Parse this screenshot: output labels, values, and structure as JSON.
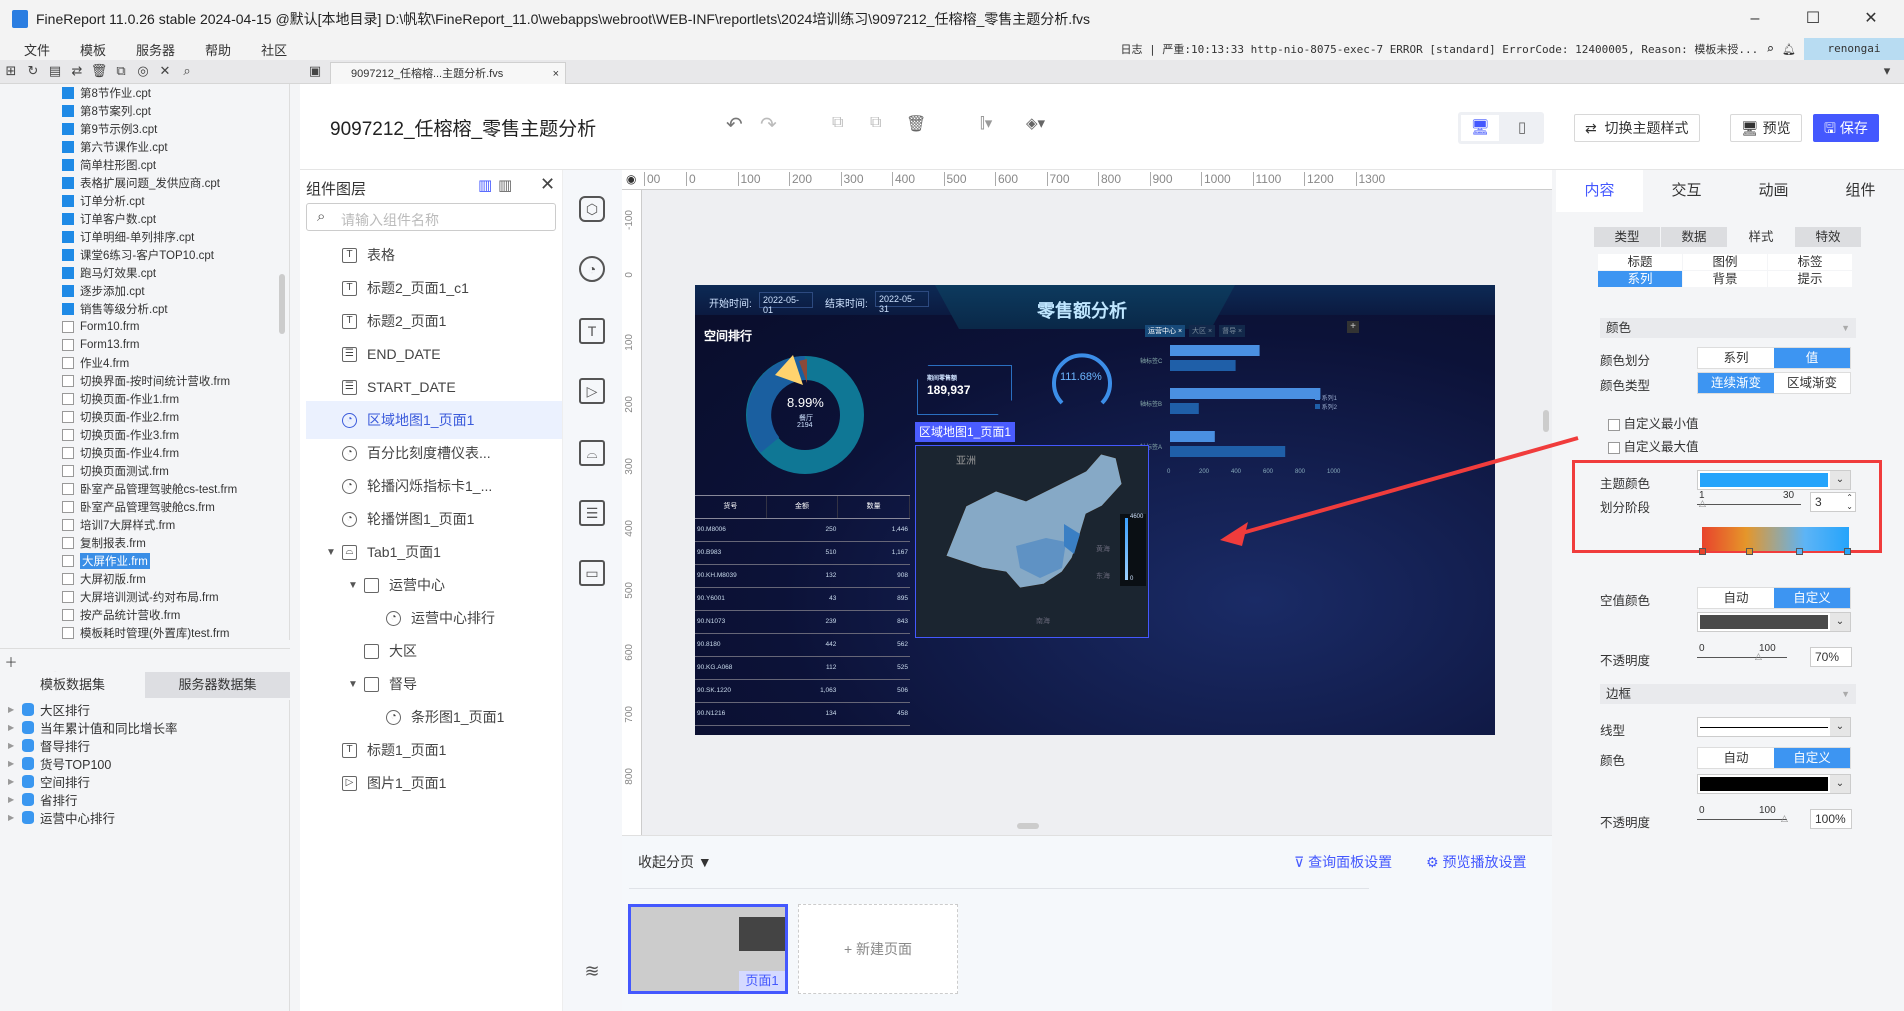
{
  "window": {
    "title": "FineReport 11.0.26 stable 2024-04-15 @默认[本地目录]   D:\\帆软\\FineReport_11.0\\webapps\\webroot\\WEB-INF\\reportlets\\2024培训练习\\9097212_任榕榕_零售主题分析.fvs",
    "minimize": "–",
    "maximize": "☐",
    "close": "✕"
  },
  "menu": [
    "文件",
    "模板",
    "服务器",
    "帮助",
    "社区"
  ],
  "log": {
    "label": "日志",
    "message": "严重:10:13:33 http-nio-8075-exec-7 ERROR [standard] ErrorCode: 12400005, Reason: 模板未授...",
    "user": "renongai"
  },
  "doc_tab": {
    "label": "9097212_任榕榕...主题分析.fvs",
    "close": "×"
  },
  "file_tree": [
    {
      "name": "第8节作业.cpt",
      "type": "cpt"
    },
    {
      "name": "第8节案列.cpt",
      "type": "cpt"
    },
    {
      "name": "第9节示例3.cpt",
      "type": "cpt"
    },
    {
      "name": "第六节课作业.cpt",
      "type": "cpt"
    },
    {
      "name": "简单柱形图.cpt",
      "type": "cpt"
    },
    {
      "name": "表格扩展问题_发供应商.cpt",
      "type": "cpt"
    },
    {
      "name": "订单分析.cpt",
      "type": "cpt"
    },
    {
      "name": "订单客户数.cpt",
      "type": "cpt"
    },
    {
      "name": "订单明细-单列排序.cpt",
      "type": "cpt"
    },
    {
      "name": "课堂6练习-客户TOP10.cpt",
      "type": "cpt"
    },
    {
      "name": "跑马灯效果.cpt",
      "type": "cpt"
    },
    {
      "name": "逐步添加.cpt",
      "type": "cpt"
    },
    {
      "name": "销售等级分析.cpt",
      "type": "cpt"
    },
    {
      "name": "Form10.frm",
      "type": "frm"
    },
    {
      "name": "Form13.frm",
      "type": "frm"
    },
    {
      "name": "作业4.frm",
      "type": "frm"
    },
    {
      "name": "切换界面-按时间统计营收.frm",
      "type": "frm"
    },
    {
      "name": "切换页面-作业1.frm",
      "type": "frm"
    },
    {
      "name": "切换页面-作业2.frm",
      "type": "frm"
    },
    {
      "name": "切换页面-作业3.frm",
      "type": "frm"
    },
    {
      "name": "切换页面-作业4.frm",
      "type": "frm"
    },
    {
      "name": "切换页面测试.frm",
      "type": "frm"
    },
    {
      "name": "卧室产品管理驾驶舱cs-test.frm",
      "type": "frm"
    },
    {
      "name": "卧室产品管理驾驶舱cs.frm",
      "type": "frm"
    },
    {
      "name": "培训7大屏样式.frm",
      "type": "frm"
    },
    {
      "name": "复制报表.frm",
      "type": "frm"
    },
    {
      "name": "大屏作业.frm",
      "type": "frm",
      "selected": true
    },
    {
      "name": "大屏初版.frm",
      "type": "frm"
    },
    {
      "name": "大屏培训测试-约对布局.frm",
      "type": "frm"
    },
    {
      "name": "按产品统计营收.frm",
      "type": "frm"
    },
    {
      "name": "模板耗时管理(外置库)test.frm",
      "type": "frm"
    }
  ],
  "dataset_tabs": [
    "模板数据集",
    "服务器数据集"
  ],
  "datasets": [
    "大区排行",
    "当年累计值和同比增长率",
    "督导排行",
    "货号TOP100",
    "空间排行",
    "省排行",
    "运营中心排行"
  ],
  "header": {
    "title": "9097212_任榕榕_零售主题分析",
    "switch_theme": "切换主题样式",
    "preview": "预览",
    "save": "保存",
    "accent": "#4458fe"
  },
  "layers": {
    "title": "组件图层",
    "search_placeholder": "请输入组件名称",
    "items": [
      {
        "label": "表格",
        "icon": "text",
        "indent": 0
      },
      {
        "label": "标题2_页面1_c1",
        "icon": "text",
        "indent": 0
      },
      {
        "label": "标题2_页面1",
        "icon": "text",
        "indent": 0
      },
      {
        "label": "END_DATE",
        "icon": "date",
        "indent": 0
      },
      {
        "label": "START_DATE",
        "icon": "date",
        "indent": 0
      },
      {
        "label": "区域地图1_页面1",
        "icon": "chart",
        "indent": 0,
        "selected": true
      },
      {
        "label": "百分比刻度槽仪表...",
        "icon": "chart",
        "indent": 0
      },
      {
        "label": "轮播闪烁指标卡1_...",
        "icon": "chart",
        "indent": 0
      },
      {
        "label": "轮播饼图1_页面1",
        "icon": "chart",
        "indent": 0
      },
      {
        "label": "Tab1_页面1",
        "icon": "tab",
        "indent": 0,
        "expanded": true
      },
      {
        "label": "运营中心",
        "icon": "folder",
        "indent": 1,
        "expanded": true
      },
      {
        "label": "运营中心排行",
        "icon": "chart",
        "indent": 2
      },
      {
        "label": "大区",
        "icon": "folder",
        "indent": 1
      },
      {
        "label": "督导",
        "icon": "folder",
        "indent": 1,
        "expanded": true
      },
      {
        "label": "条形图1_页面1",
        "icon": "chart",
        "indent": 2
      },
      {
        "label": "标题1_页面1",
        "icon": "text",
        "indent": 0
      },
      {
        "label": "图片1_页面1",
        "icon": "image",
        "indent": 0
      }
    ]
  },
  "ruler": [
    "00",
    "0",
    "100",
    "200",
    "300",
    "400",
    "500",
    "600",
    "700",
    "800",
    "900",
    "1000",
    "1100",
    "1200",
    "1300"
  ],
  "ruler_v": [
    "-100",
    "0",
    "100",
    "200",
    "300",
    "400",
    "500",
    "600",
    "700",
    "800"
  ],
  "dashboard": {
    "title": "零售额分析",
    "start_label": "开始时间:",
    "start_value": "2022-05-01",
    "end_label": "结束时间:",
    "end_value": "2022-05-31",
    "donut": {
      "title": "空间排行",
      "percent": "8.99%",
      "name": "餐厅",
      "value": "2194"
    },
    "table": {
      "headers": [
        "货号",
        "金额",
        "数量"
      ],
      "rows": [
        [
          "90.M8006",
          "250",
          "1,446"
        ],
        [
          "90.B983",
          "510",
          "1,167"
        ],
        [
          "90.KH.M8039",
          "132",
          "908"
        ],
        [
          "90.Y6001",
          "43",
          "895"
        ],
        [
          "90.N1073",
          "239",
          "843"
        ],
        [
          "90.8180",
          "442",
          "562"
        ],
        [
          "90.KG.A068",
          "112",
          "525"
        ],
        [
          "90.SK.1220",
          "1,063",
          "506"
        ],
        [
          "90.N1216",
          "134",
          "458"
        ]
      ]
    },
    "kpi": {
      "label": "期间零售额",
      "value": "189,937"
    },
    "gauge": {
      "value": "111.68%"
    },
    "tabs": [
      "运营中心",
      "大区",
      "督导"
    ],
    "bar": {
      "categories": [
        "轴标签C",
        "轴标签B",
        "轴标签A"
      ],
      "series": [
        {
          "name": "系列1",
          "values": [
            560,
            940,
            280
          ]
        },
        {
          "name": "系列2",
          "values": [
            410,
            180,
            720
          ]
        }
      ],
      "ticks": [
        "0",
        "200",
        "400",
        "600",
        "800",
        "1000"
      ]
    },
    "map": {
      "label": "区域地图1_页面1",
      "region": "亚洲",
      "max": "4600",
      "min": "0",
      "sea1": "黄海",
      "sea2": "东海",
      "sea3": "南海"
    }
  },
  "pages": {
    "collapse": "收起分页",
    "query_panel": "查询面板设置",
    "preview_play": "预览播放设置",
    "page1": "页面1",
    "new_page": "+ 新建页面"
  },
  "right": {
    "tabs": [
      "内容",
      "交互",
      "动画",
      "组件"
    ],
    "subtabs": [
      "类型",
      "数据",
      "样式",
      "特效"
    ],
    "style_tabs": [
      "标题",
      "图例",
      "标签",
      "系列",
      "背景",
      "提示"
    ],
    "color_section": "颜色",
    "color_split": {
      "label": "颜色划分",
      "options": [
        "系列",
        "值"
      ],
      "selected": "值"
    },
    "color_type": {
      "label": "颜色类型",
      "options": [
        "连续渐变",
        "区域渐变"
      ],
      "selected": "连续渐变"
    },
    "custom_min": "自定义最小值",
    "custom_max": "自定义最大值",
    "theme_color": {
      "label": "主题颜色",
      "color": "#25a4fb"
    },
    "stages": {
      "label": "划分阶段",
      "min": "1",
      "max": "30",
      "value": "3",
      "gradient": [
        "#e8432c",
        "#e5962a",
        "#5db4f6",
        "#25a4fb"
      ]
    },
    "null_color": {
      "label": "空值颜色",
      "options": [
        "自动",
        "自定义"
      ],
      "selected": "自定义",
      "color": "#4a4a4a"
    },
    "opacity1": {
      "label": "不透明度",
      "min": "0",
      "max": "100",
      "value": "70%",
      "level": 70
    },
    "border_section": "边框",
    "line_type": "线型",
    "border_color": {
      "label": "颜色",
      "options": [
        "自动",
        "自定义"
      ],
      "selected": "自定义",
      "color": "#000000"
    },
    "opacity2": {
      "label": "不透明度",
      "min": "0",
      "max": "100",
      "value": "100%",
      "level": 100
    }
  }
}
